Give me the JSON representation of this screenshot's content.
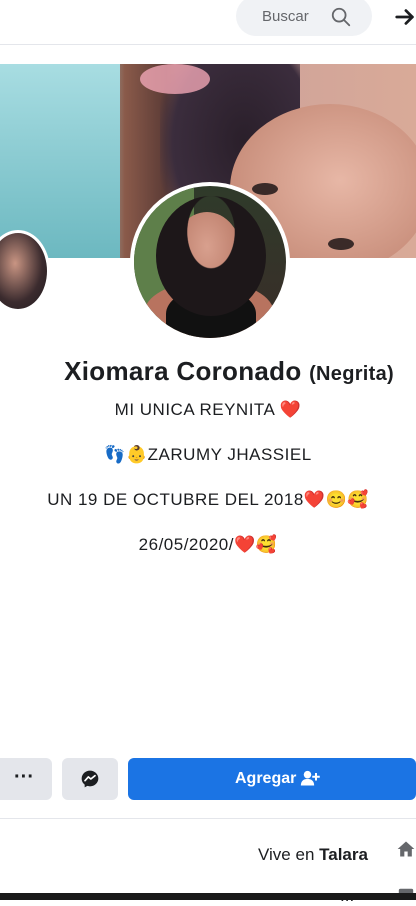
{
  "search": {
    "placeholder": "Buscar"
  },
  "profile": {
    "name": "Xiomara Coronado",
    "nickname": "(Negrita)",
    "bio_lines": [
      "MI UNICA REYNITA ❤️",
      "👣👶ZARUMY JHASSIEL",
      "UN 19 DE OCTUBRE DEL 2018❤️😊🥰",
      "26/05/2020/❤️🥰"
    ]
  },
  "actions": {
    "add_label": "Agregar",
    "more_label": "···"
  },
  "info": {
    "lives_in_prefix": "Vive en ",
    "lives_in_city": "Talara",
    "next_row_text": "..."
  },
  "colors": {
    "primary": "#1b74e4",
    "secondary_btn": "#e4e6eb"
  }
}
